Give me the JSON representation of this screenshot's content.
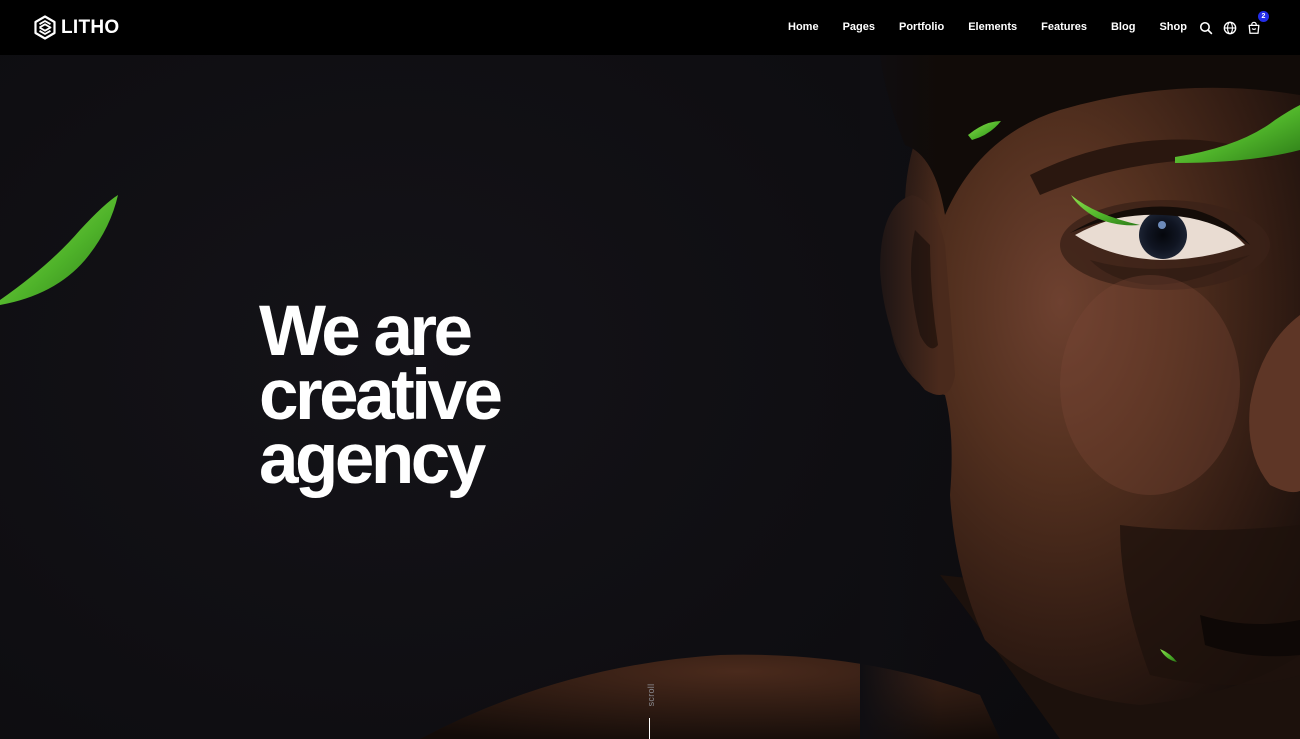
{
  "brand": {
    "name": "LITHO",
    "logo_icon": "litho-logo-icon"
  },
  "nav": {
    "items": [
      {
        "label": "Home"
      },
      {
        "label": "Pages"
      },
      {
        "label": "Portfolio"
      },
      {
        "label": "Elements"
      },
      {
        "label": "Features"
      },
      {
        "label": "Blog"
      },
      {
        "label": "Shop"
      }
    ]
  },
  "header_icons": {
    "search": "search-icon",
    "language": "globe-icon",
    "cart": "cart-icon",
    "cart_count": "2"
  },
  "hero": {
    "heading_lines": [
      "We are",
      "creative",
      "agency"
    ],
    "image": "man-face-with-green-leaves",
    "scroll_label": "scroll"
  },
  "colors": {
    "header_bg": "#000000",
    "hero_bg": "#0f0e12",
    "text": "#ffffff",
    "badge": "#232de8",
    "leaf_green": "#4fb32a"
  }
}
